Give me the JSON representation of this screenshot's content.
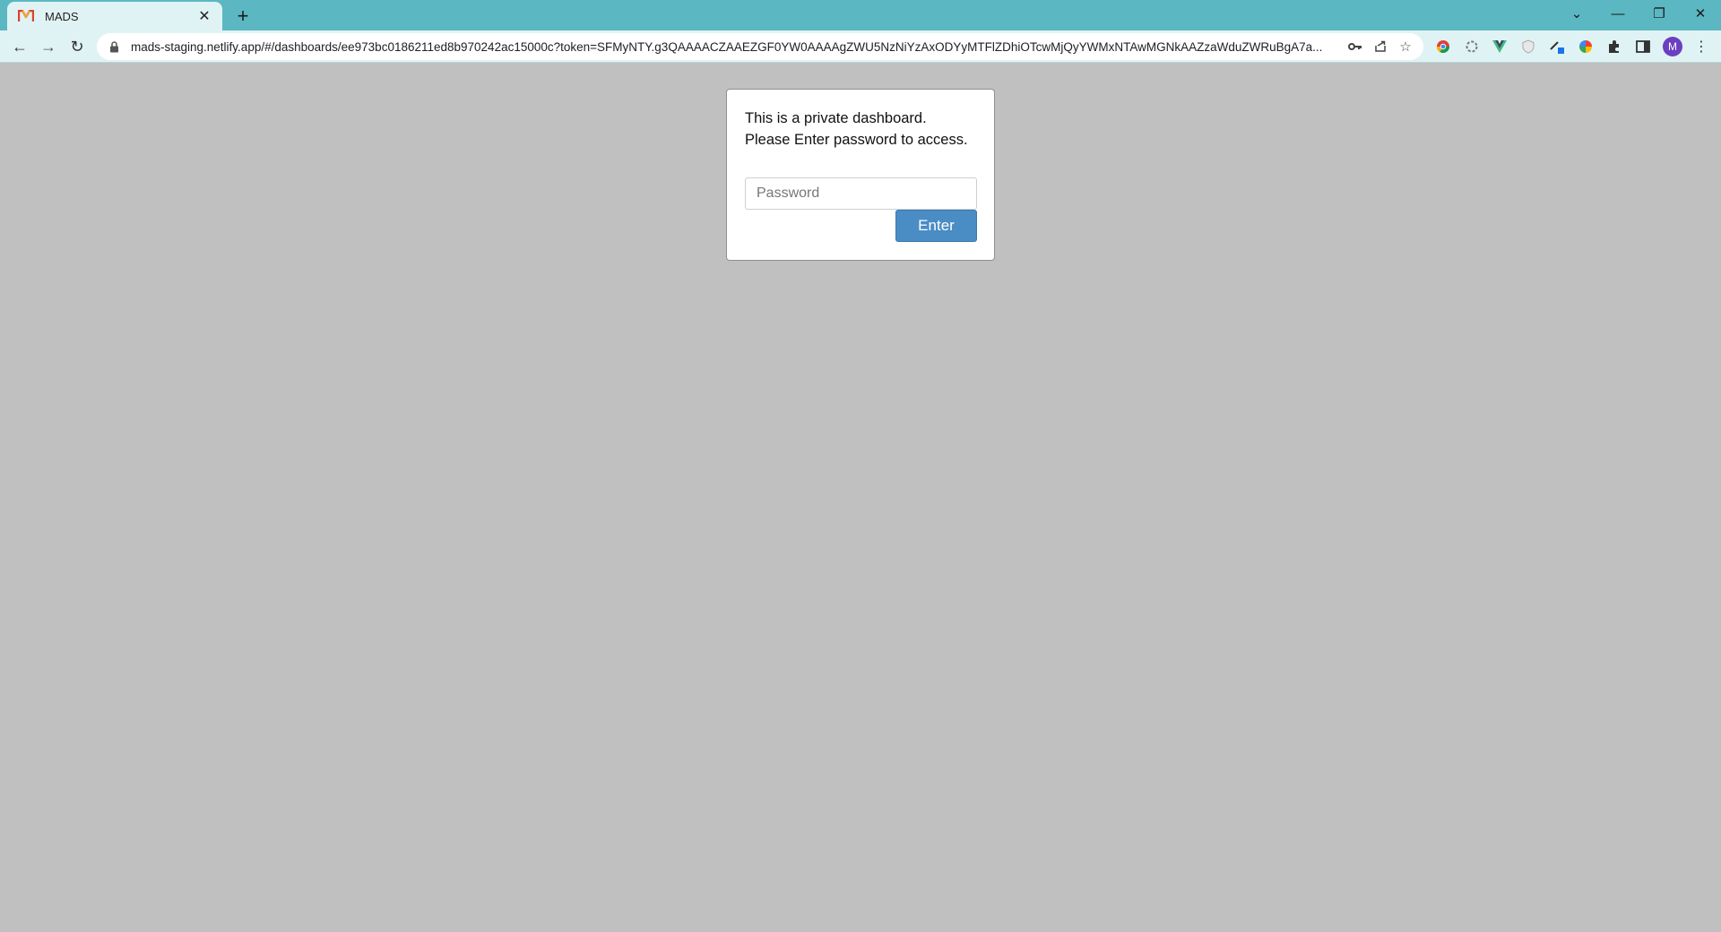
{
  "browser": {
    "tab": {
      "title": "MADS",
      "close": "✕"
    },
    "new_tab": "+",
    "window_controls": {
      "tab_search": "⌄",
      "minimize": "—",
      "restore": "❐",
      "close": "✕"
    },
    "nav": {
      "back": "←",
      "forward": "→",
      "reload": "↻"
    },
    "url": "mads-staging.netlify.app/#/dashboards/ee973bc0186211ed8b970242ac15000c?token=SFMyNTY.g3QAAAACZAAEZGF0YW0AAAAgZWU5NzNiYzAxODYyMTFlZDhiOTcwMjQyYWMxNTAwMGNkAAZzaWduZWRuBgA7a...",
    "extensions": [
      "chrome-icon",
      "sync-icon",
      "vue-icon",
      "shield-icon",
      "pen-icon",
      "color-wheel-icon",
      "puzzle-icon",
      "sidepanel-icon"
    ],
    "profile_initial": "M"
  },
  "dialog": {
    "message_line1": "This is a private dashboard.",
    "message_line2": "Please Enter password to access.",
    "password_placeholder": "Password",
    "password_value": "",
    "enter_label": "Enter"
  },
  "colors": {
    "tabbar": "#5bb7c1",
    "toolbar": "#e0f3f4",
    "page_background": "#c0c0c0",
    "button": "#4a8cc4"
  }
}
